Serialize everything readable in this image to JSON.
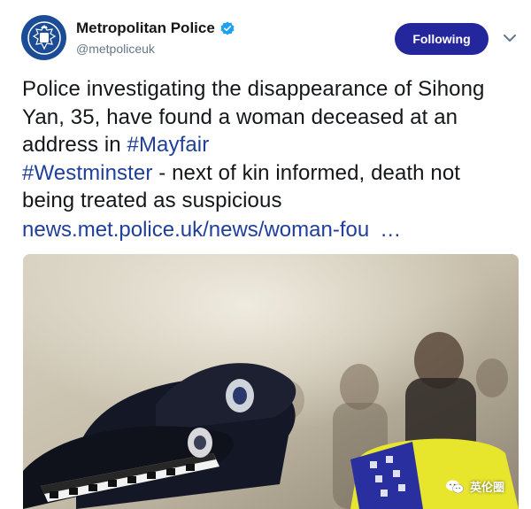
{
  "account": {
    "display_name": "Metropolitan Police",
    "handle": "@metpoliceuk",
    "verified": true,
    "avatar_icon": "met-police-crest-icon"
  },
  "follow_button": {
    "label": "Following",
    "color": "#24279c"
  },
  "menu_icon": "chevron-down-icon",
  "tweet": {
    "text_before": "Police investigating the disappearance of Sihong Yan, 35, have found a woman deceased at an address in ",
    "hashtag_1": "#Mayfair",
    "hashtag_2": "#Westminster",
    "text_after": " - next of kin informed, death not being treated as suspicious",
    "link": "news.met.police.uk/news/woman-fou",
    "link_ellipsis": "…",
    "link_color": "#1f3f9a"
  },
  "media": {
    "watermark_text": "英伦圈",
    "watermark_icon": "wechat-icon"
  }
}
